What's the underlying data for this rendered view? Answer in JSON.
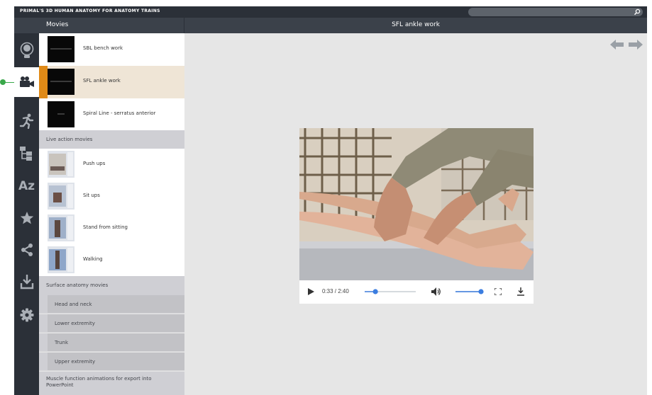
{
  "app": {
    "title": "PRIMAL'S 3D HUMAN ANATOMY FOR ANATOMY TRAINS"
  },
  "search": {
    "placeholder": ""
  },
  "header": {
    "list_title": "Movies",
    "main_title": "SFL ankle work"
  },
  "sidebar": {
    "items": [
      {
        "icon": "anatomy-head-icon",
        "active": false
      },
      {
        "icon": "video-camera-icon",
        "active": true
      },
      {
        "icon": "running-figure-icon",
        "active": false
      },
      {
        "icon": "hierarchy-icon",
        "active": false
      },
      {
        "icon": "a-z-icon",
        "label": "Az",
        "active": false
      },
      {
        "icon": "star-icon",
        "active": false
      },
      {
        "icon": "share-icon",
        "active": false
      },
      {
        "icon": "download-icon",
        "active": false
      },
      {
        "icon": "gear-icon",
        "active": false
      }
    ]
  },
  "list": {
    "movies": [
      {
        "label": "SBL bench work"
      },
      {
        "label": "SFL ankle work",
        "active": true
      },
      {
        "label": "Spiral Line - serratus anterior"
      }
    ],
    "live_action_header": "Live action movies",
    "live_action": [
      {
        "label": "Push ups"
      },
      {
        "label": "Sit ups"
      },
      {
        "label": "Stand from sitting"
      },
      {
        "label": "Walking"
      }
    ],
    "surface_header": "Surface anatomy movies",
    "surface": [
      {
        "label": "Head and neck"
      },
      {
        "label": "Lower extremity"
      },
      {
        "label": "Trunk"
      },
      {
        "label": "Upper extremity"
      }
    ],
    "muscle_header": "Muscle function animations for export into PowerPoint"
  },
  "video": {
    "time": "0:33 / 2:40",
    "progress": 0.21,
    "volume": 1.0
  },
  "colors": {
    "accent": "#e08a17",
    "dark": "#2b3038",
    "slider": "#3b7de0",
    "pointer": "#3aa84a"
  }
}
